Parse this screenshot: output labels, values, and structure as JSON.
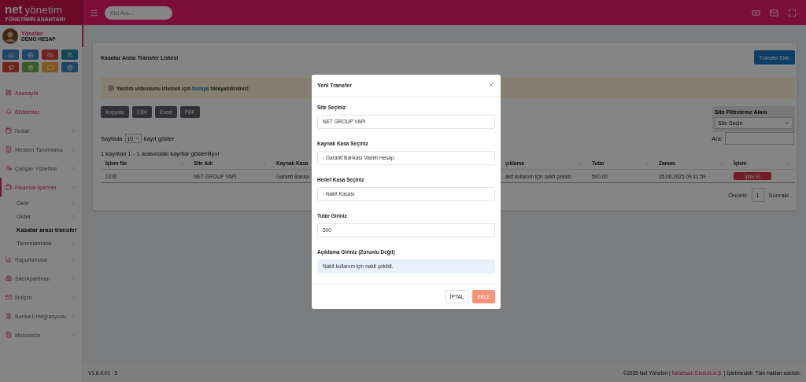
{
  "topbar": {
    "logo_mark": "net",
    "logo_text": "yönetim",
    "logo_tagline": "YÖNETİMİN ANAHTARI",
    "search": {
      "placeholder": "Kişi Ara..."
    }
  },
  "user": {
    "role": "Yönetici",
    "name": "DEMO HESAP"
  },
  "sidebar": {
    "items": [
      {
        "label": "Anasayfa",
        "kind": "link",
        "selected": false
      },
      {
        "label": "Bildirimler",
        "kind": "link",
        "selected": false
      },
      {
        "label": "Notlar",
        "kind": "group",
        "selected": false,
        "expanded": false
      },
      {
        "label": "Mesken Tanımlama",
        "kind": "group",
        "selected": false,
        "expanded": false
      },
      {
        "label": "Çalışan Yönetimi",
        "kind": "group",
        "selected": false,
        "expanded": false
      },
      {
        "label": "Finansal İşlemler",
        "kind": "group",
        "selected": true,
        "expanded": true,
        "children": [
          {
            "label": "Gelir",
            "has_submenu": true,
            "selected": false
          },
          {
            "label": "Gider",
            "has_submenu": true,
            "selected": false
          },
          {
            "label": "Kasalar arası transfer",
            "has_submenu": false,
            "selected": true
          },
          {
            "label": "Tanımlamalar",
            "has_submenu": true,
            "selected": false
          }
        ]
      },
      {
        "label": "Raporlamalar",
        "kind": "group",
        "selected": false,
        "expanded": false
      },
      {
        "label": "Site/Apartman",
        "kind": "group",
        "selected": false,
        "expanded": false
      },
      {
        "label": "İletişim",
        "kind": "group",
        "selected": false,
        "expanded": false
      },
      {
        "label": "Banka Entegrasyonu",
        "kind": "group",
        "selected": false,
        "expanded": false
      },
      {
        "label": "Muhasebe",
        "kind": "group",
        "selected": false,
        "expanded": false
      }
    ]
  },
  "card": {
    "title": "Kasalar Arası Transfer Listesi",
    "add_button": "Transfer Ekle",
    "alert": {
      "before": "Yardım videosunu izlemek için",
      "link": "buraya",
      "after": "tıklayabilirsiniz!"
    },
    "export_buttons": [
      "Kopyala",
      "CSV",
      "Excel",
      "PDF"
    ],
    "page_size": {
      "before": "Sayfada",
      "value": "10",
      "after": "kayıt göster"
    },
    "filter": {
      "title": "Site Filtreleme Alanı",
      "value": "Site Seçin"
    },
    "search_label": "Ara:",
    "info": "1 kayıttan 1 - 1 arasındaki kayıtlar gösteriliyor",
    "table": {
      "columns": [
        {
          "label": "İşlem No",
          "sort_icon": true
        },
        {
          "label": "Site Adı",
          "sort_icon": true
        },
        {
          "label": "Kaynak Kasa"
        },
        {
          "label": "çıklama",
          "sort_icon": true
        },
        {
          "label": "Tutar",
          "sort_icon": true
        },
        {
          "label": "Zaman",
          "sort_icon": true
        },
        {
          "label": "İşlem",
          "sort_icon": true
        }
      ],
      "rows": [
        {
          "cells": [
            "1230",
            "NET GROUP YAPI",
            "Garanti Banka",
            "akit kullanım için nakit çekildi.",
            "500.00",
            "25.06.2025 09:42:59"
          ],
          "action": "İptal Et"
        }
      ]
    },
    "pagination": {
      "previous": "Önceki",
      "page": "1",
      "next": "Sonraki"
    }
  },
  "footer": {
    "version": "V1.6.4.01 - 5",
    "copyright_before": "©2025 Net Yönetim |",
    "company": "Netahsan Elektrik A.Ş.",
    "copyright_after": "| İşletmesidir. Tüm hakları saklıdır."
  },
  "modal": {
    "title": "Yeni Transfer",
    "fields": [
      {
        "label": "Site Seçiniz",
        "value": "NET GROUP YAPI",
        "kind": "select"
      },
      {
        "label": "Kaynak Kasa Seçiniz",
        "value": "- Garanti Bankası Vadeli Hesap",
        "kind": "select"
      },
      {
        "label": "Hedef Kasa Seçiniz",
        "value": "- Nakit Kasası",
        "kind": "select"
      },
      {
        "label": "Tutar Giriniz",
        "value": "500",
        "kind": "input"
      },
      {
        "label": "Açıklama Giriniz (Zorunlu Değil)",
        "value": "Nakit kullanım için nakit çekildi.",
        "kind": "autofilled"
      }
    ],
    "cancel": "İPTAL",
    "submit": "EKLE"
  }
}
